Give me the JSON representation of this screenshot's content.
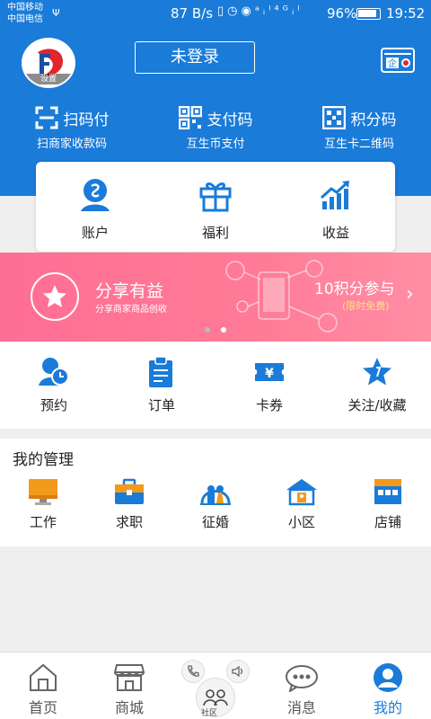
{
  "status_bar": {
    "carrier1": "中国移动",
    "carrier2": "中国电信",
    "speed": "87 B/s",
    "battery": "96%",
    "time": "19:52"
  },
  "header": {
    "avatar_label": "设置",
    "login_label": "未登录"
  },
  "pay_row": [
    {
      "label": "扫码付",
      "sub": "扫商家收款码"
    },
    {
      "label": "支付码",
      "sub": "互生币支付"
    },
    {
      "label": "积分码",
      "sub": "互生卡二维码"
    }
  ],
  "account_card": [
    {
      "label": "账户"
    },
    {
      "label": "福利"
    },
    {
      "label": "收益"
    }
  ],
  "banner": {
    "title": "分享有益",
    "subtitle": "分享商家商品创收",
    "points": "10积分参与",
    "free": "(限时免费)"
  },
  "quick_row": [
    {
      "label": "预约"
    },
    {
      "label": "订单"
    },
    {
      "label": "卡券"
    },
    {
      "label": "关注/收藏"
    }
  ],
  "management": {
    "title": "我的管理",
    "items": [
      {
        "label": "工作"
      },
      {
        "label": "求职"
      },
      {
        "label": "征婚"
      },
      {
        "label": "小区"
      },
      {
        "label": "店铺"
      }
    ]
  },
  "tabbar": {
    "tabs": [
      {
        "label": "首页"
      },
      {
        "label": "商城"
      },
      {
        "label": "消息"
      },
      {
        "label": "我的"
      }
    ],
    "center_label": "社区"
  },
  "colors": {
    "primary": "#1a7bd9",
    "banner_pink": "#ff7b97",
    "orange": "#f39a1c"
  }
}
